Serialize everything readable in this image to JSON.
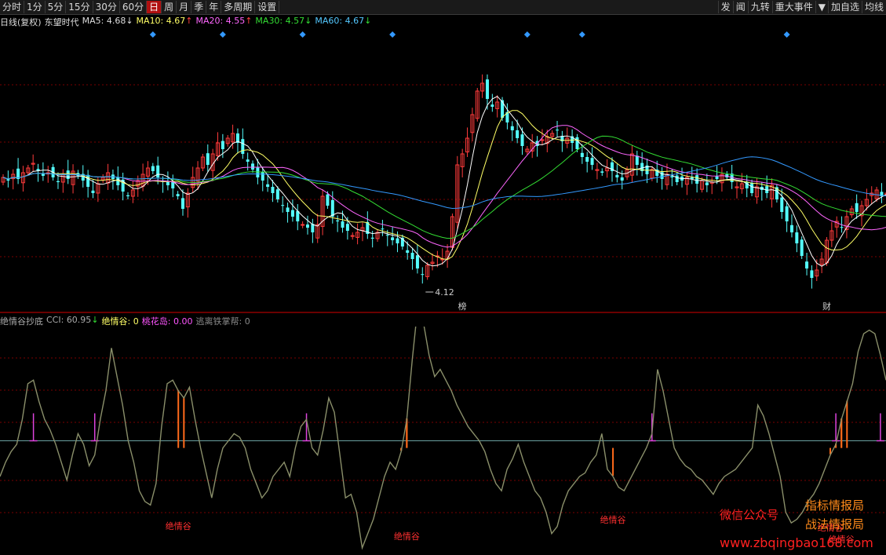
{
  "toolbar": {
    "periods": [
      "分时",
      "1分",
      "5分",
      "15分",
      "30分",
      "60分",
      "日",
      "周",
      "月",
      "季",
      "年",
      "多周期",
      "设置"
    ],
    "active_period": "日",
    "right_buttons": [
      "发",
      "闻",
      "九转",
      "重大事件",
      "▼",
      "加自选",
      "均线"
    ]
  },
  "infobar": {
    "chart_type": "日线(复权)",
    "stock_name": "东望时代",
    "ma5_label": "MA5:",
    "ma5_value": "4.68",
    "ma5_arrow": "↓",
    "ma10_label": "MA10:",
    "ma10_value": "4.67",
    "ma10_arrow": "↑",
    "ma20_label": "MA20:",
    "ma20_value": "4.55",
    "ma20_arrow": "↑",
    "ma30_label": "MA30:",
    "ma30_value": "4.57",
    "ma30_arrow": "↓",
    "ma60_label": "MA60:",
    "ma60_value": "4.67",
    "ma60_arrow": "↓"
  },
  "indicator_bar": {
    "name": "绝情谷抄底",
    "cci_label": "CCI:",
    "cci_value": "60.95",
    "cci_arrow": "↓",
    "jqg_label": "绝情谷:",
    "jqg_value": "0",
    "thd_label": "桃花岛:",
    "thd_value": "0.00",
    "tlc_label": "逃离铁掌帮:",
    "tlc_value": "0"
  },
  "colors": {
    "up": "#ff3b3b",
    "down": "#54ffff",
    "ma5": "#ffffff",
    "ma10": "#ffff66",
    "ma20": "#ff66ff",
    "ma30": "#33dd33",
    "ma60": "#3399ff",
    "cci": "#8a8f6a",
    "jqg": "#ff6a1a",
    "thd": "#dd44dd",
    "grid": "#7a0000"
  },
  "chart_data": [
    {
      "type": "candlestick",
      "title": "东望时代 日线(复权)",
      "price_range": [
        3.95,
        5.75
      ],
      "low_annotation": "4.12",
      "markers": [
        "榜",
        "财"
      ],
      "close": [
        4.8,
        4.78,
        4.82,
        4.79,
        4.83,
        4.86,
        4.89,
        4.84,
        4.81,
        4.83,
        4.8,
        4.77,
        4.82,
        4.79,
        4.84,
        4.81,
        4.78,
        4.74,
        4.7,
        4.76,
        4.8,
        4.83,
        4.79,
        4.75,
        4.71,
        4.68,
        4.72,
        4.78,
        4.82,
        4.86,
        4.84,
        4.8,
        4.77,
        4.75,
        4.73,
        4.68,
        4.6,
        4.7,
        4.8,
        4.86,
        4.93,
        4.88,
        4.95,
        5.02,
        4.98,
        5.05,
        5.08,
        5.02,
        4.95,
        4.9,
        4.85,
        4.8,
        4.78,
        4.74,
        4.7,
        4.66,
        4.62,
        4.58,
        4.55,
        4.52,
        4.5,
        4.48,
        4.45,
        4.5,
        4.68,
        4.62,
        4.55,
        4.52,
        4.48,
        4.46,
        4.43,
        4.45,
        4.48,
        4.44,
        4.41,
        4.45,
        4.47,
        4.43,
        4.4,
        4.38,
        4.36,
        4.32,
        4.28,
        4.22,
        4.18,
        4.24,
        4.26,
        4.3,
        4.28,
        4.33,
        4.55,
        4.88,
        4.95,
        5.05,
        5.2,
        5.35,
        5.4,
        5.3,
        5.25,
        5.28,
        5.18,
        5.15,
        5.1,
        5.05,
        5.0,
        4.98,
        5.02,
        5.0,
        5.04,
        5.06,
        5.08,
        5.1,
        5.03,
        5.05,
        5.02,
        4.98,
        4.93,
        4.9,
        4.88,
        4.85,
        4.83,
        4.86,
        4.84,
        4.8,
        4.78,
        4.85,
        4.95,
        4.88,
        4.84,
        4.82,
        4.85,
        4.81,
        4.79,
        4.82,
        4.8,
        4.77,
        4.78,
        4.8,
        4.79,
        4.76,
        4.78,
        4.75,
        4.77,
        4.79,
        4.82,
        4.8,
        4.77,
        4.74,
        4.76,
        4.73,
        4.7,
        4.74,
        4.72,
        4.7,
        4.75,
        4.66,
        4.58,
        4.52,
        4.45,
        4.38,
        4.3,
        4.22,
        4.16,
        4.21,
        4.28,
        4.4,
        4.46,
        4.52,
        4.48,
        4.55,
        4.6,
        4.58,
        4.62,
        4.66,
        4.7,
        4.72,
        4.68,
        4.7
      ],
      "ma_values": {
        "MA5": 4.68,
        "MA10": 4.67,
        "MA20": 4.55,
        "MA30": 4.57,
        "MA60": 4.67
      }
    },
    {
      "type": "line",
      "title": "绝情谷抄底",
      "cci_range": [
        -320,
        320
      ],
      "cci": [
        -100,
        -60,
        -30,
        -10,
        60,
        160,
        170,
        110,
        60,
        30,
        -10,
        -60,
        -110,
        -40,
        20,
        -10,
        -70,
        -40,
        60,
        140,
        260,
        180,
        100,
        0,
        -60,
        -140,
        -170,
        -180,
        -120,
        40,
        160,
        170,
        140,
        120,
        150,
        60,
        -20,
        -90,
        -160,
        -80,
        -20,
        0,
        20,
        10,
        -20,
        -80,
        -120,
        -160,
        -140,
        -100,
        -80,
        -60,
        -100,
        -20,
        40,
        60,
        -20,
        -40,
        30,
        120,
        80,
        -40,
        -160,
        -150,
        -200,
        -300,
        -260,
        -220,
        -160,
        -100,
        -60,
        -80,
        -30,
        60,
        230,
        380,
        330,
        240,
        180,
        200,
        170,
        140,
        100,
        70,
        40,
        20,
        0,
        -30,
        -80,
        -120,
        -140,
        -80,
        -50,
        -10,
        -60,
        -100,
        -140,
        -160,
        -200,
        -260,
        -240,
        -180,
        -140,
        -120,
        -100,
        -90,
        -60,
        -40,
        20,
        -80,
        -100,
        -130,
        -140,
        -110,
        -80,
        -50,
        -20,
        20,
        200,
        140,
        60,
        -20,
        -50,
        -70,
        -80,
        -100,
        -110,
        -130,
        -150,
        -120,
        -100,
        -90,
        -80,
        -60,
        -40,
        -20,
        100,
        70,
        20,
        -40,
        -100,
        -200,
        -230,
        -220,
        -200,
        -170,
        -150,
        -120,
        -80,
        -40,
        -10,
        60,
        110,
        160,
        250,
        300,
        310,
        300,
        240,
        170
      ],
      "jqg_bars": [
        61,
        62,
        135,
        136,
        137,
        138,
        208,
        282,
        283,
        284,
        285,
        286
      ],
      "jqg_labels": [
        "绝情谷",
        "绝情谷",
        "绝情谷",
        "绝情谷"
      ],
      "thd_spikes": [
        12,
        32,
        103,
        221,
        283,
        298
      ]
    }
  ],
  "watermark": {
    "line1": "指标情报局",
    "line2": "战法情报局",
    "wechat": "微信公众号",
    "url": "www.zbqingbao168.com"
  }
}
